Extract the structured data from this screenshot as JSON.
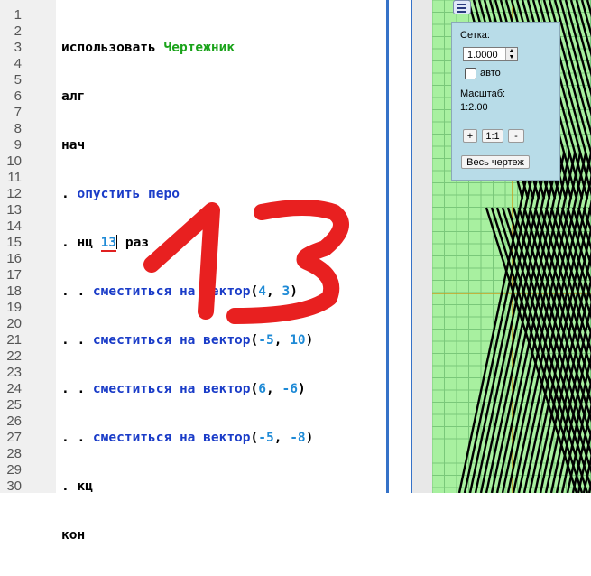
{
  "editor": {
    "line_numbers": [
      "1",
      "2",
      "3",
      "4",
      "5",
      "6",
      "7",
      "8",
      "9",
      "10",
      "11",
      "12",
      "13",
      "14",
      "15",
      "16",
      "17",
      "18",
      "19",
      "20",
      "21",
      "22",
      "23",
      "24",
      "25",
      "26",
      "27",
      "28",
      "29",
      "30"
    ],
    "lines": {
      "l1_kw": "использовать ",
      "l1_mod": "Чертежник",
      "l2": "алг",
      "l3": "нач",
      "l4_dot": ". ",
      "l4_cmd": "опустить перо",
      "l5_a": ". нц ",
      "l5_num": "13",
      "l5_b": " раз",
      "l6_dot": ". . ",
      "l6_cmd": "сместиться на вектор",
      "l6_open": "(",
      "l6_x": "4",
      "l6_sep": ", ",
      "l6_y": "3",
      "l6_close": ")",
      "l7_dot": ". . ",
      "l7_cmd": "сместиться на вектор",
      "l7_open": "(",
      "l7_x": "-5",
      "l7_sep": ", ",
      "l7_y": "10",
      "l7_close": ")",
      "l8_dot": ". . ",
      "l8_cmd": "сместиться на вектор",
      "l8_open": "(",
      "l8_x": "6",
      "l8_sep": ", ",
      "l8_y": "-6",
      "l8_close": ")",
      "l9_dot": ". . ",
      "l9_cmd": "сместиться на вектор",
      "l9_open": "(",
      "l9_x": "-5",
      "l9_sep": ", ",
      "l9_y": "-8",
      "l9_close": ")",
      "l10": ". кц",
      "l11": "кон"
    },
    "annotation": "13"
  },
  "panel": {
    "grid_label": "Сетка:",
    "grid_value": "1.0000",
    "auto_label": "авто",
    "scale_label": "Масштаб:",
    "scale_value": "1:2.00",
    "zoom_in": "+",
    "zoom_reset": "1:1",
    "zoom_out": "-",
    "fit_all": "Весь чертеж"
  },
  "colors": {
    "grid_bg": "#a8f0a0",
    "grid_line": "#7ac87a",
    "axis": "#c8a020",
    "drawing_line": "#000000",
    "annotation": "#e82020"
  }
}
